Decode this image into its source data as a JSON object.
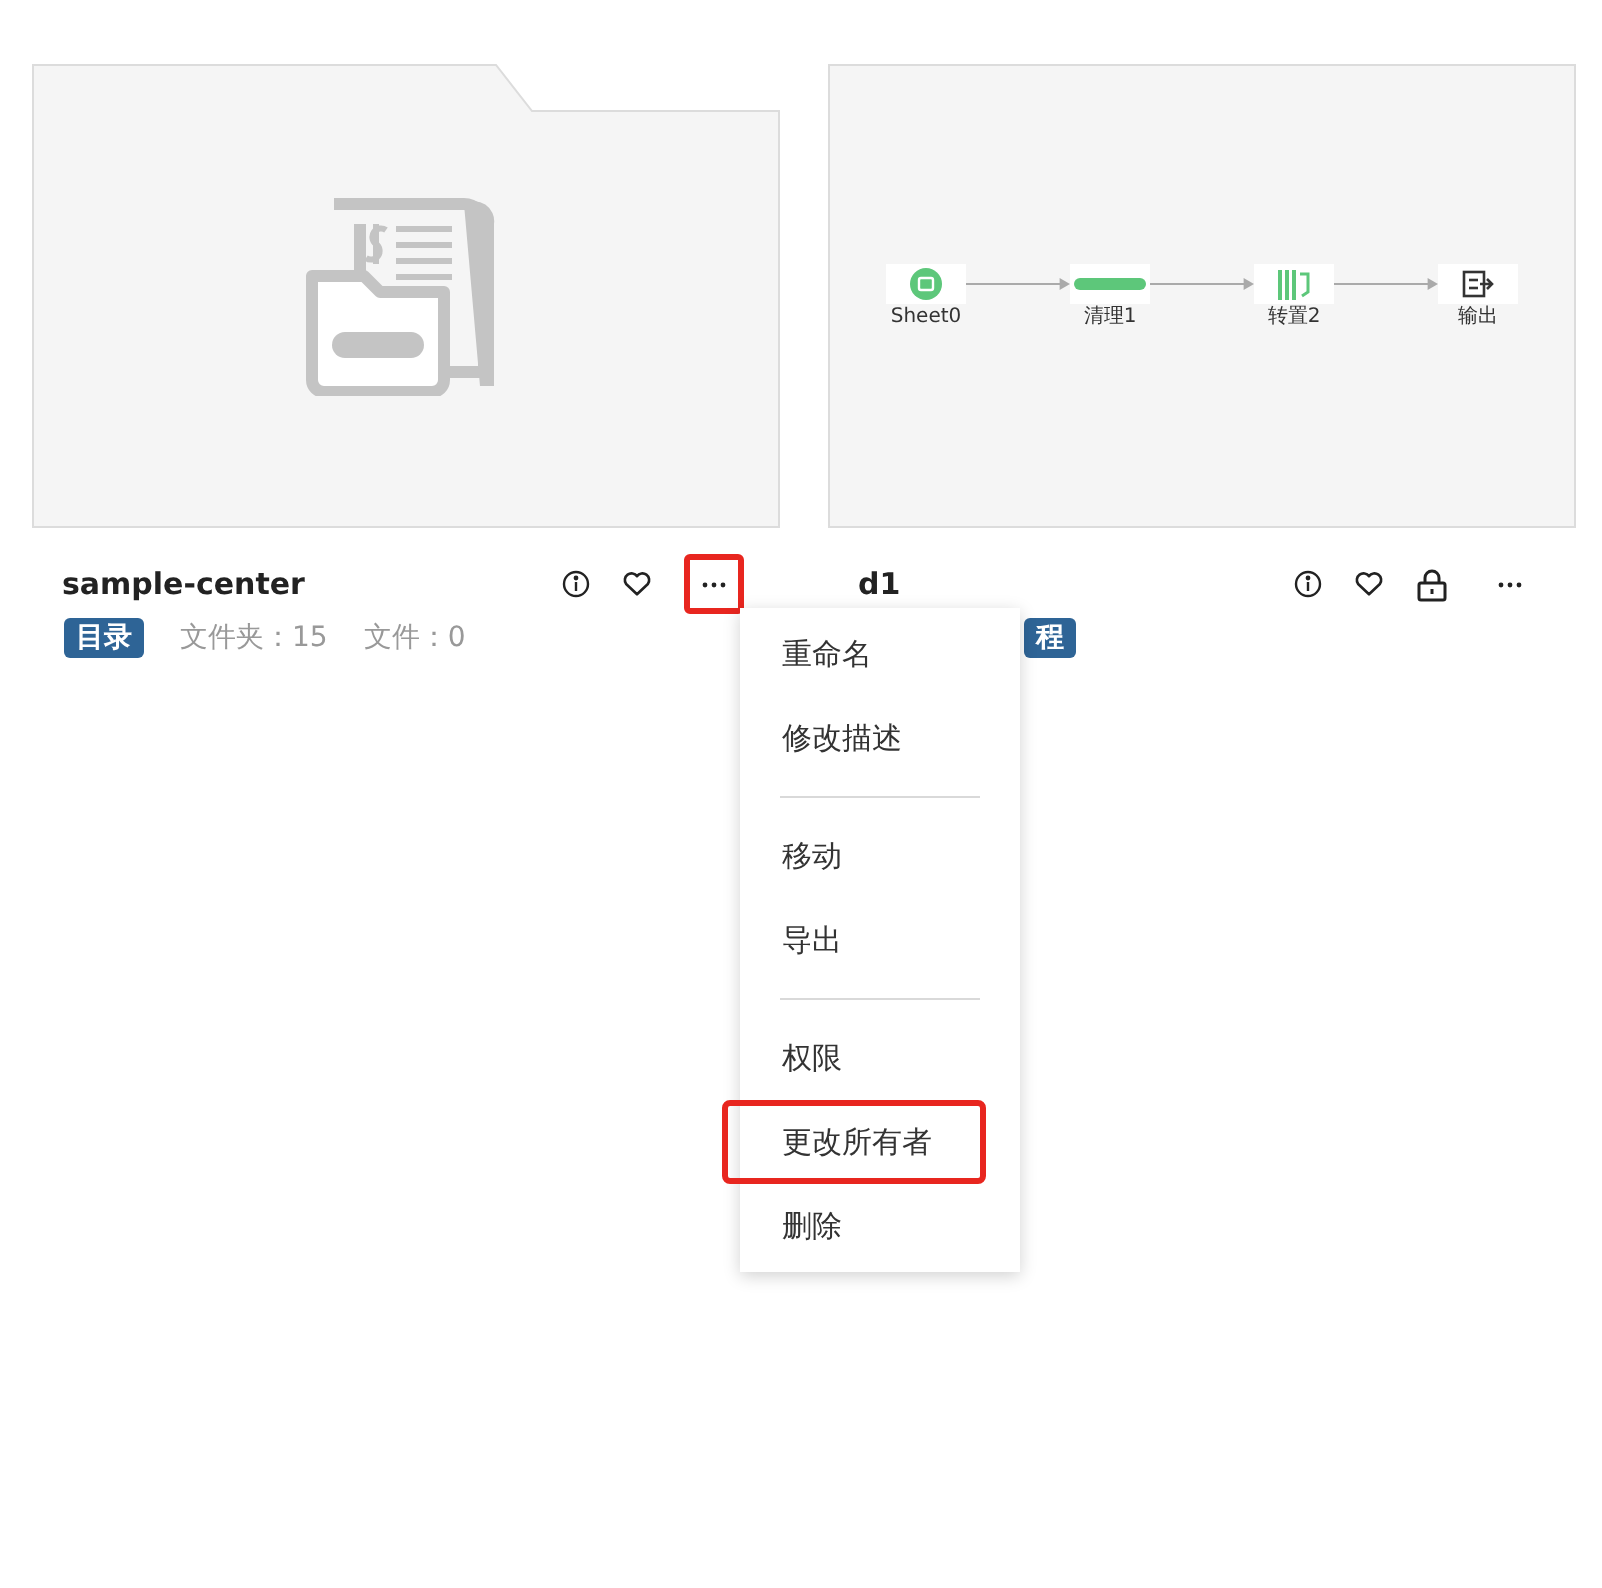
{
  "cards": [
    {
      "kind": "folder",
      "title": "sample-center",
      "tag": "目录",
      "stats": [
        "文件夹：15",
        "文件：0"
      ],
      "locked": false,
      "more_highlighted": true
    },
    {
      "kind": "flow",
      "title": "d1",
      "tag": "程",
      "locked": true,
      "more_highlighted": false,
      "flow": {
        "nodes": [
          {
            "kind": "sheet",
            "label": "Sheet0"
          },
          {
            "kind": "clean",
            "label": "清理1"
          },
          {
            "kind": "transpose",
            "label": "转置2"
          },
          {
            "kind": "output",
            "label": "输出"
          }
        ]
      }
    }
  ],
  "menu": {
    "items": [
      {
        "kind": "item",
        "label": "重命名",
        "highlighted": false
      },
      {
        "kind": "item",
        "label": "修改描述",
        "highlighted": false
      },
      {
        "kind": "divider"
      },
      {
        "kind": "item",
        "label": "移动",
        "highlighted": false
      },
      {
        "kind": "item",
        "label": "导出",
        "highlighted": false
      },
      {
        "kind": "divider"
      },
      {
        "kind": "item",
        "label": "权限",
        "highlighted": false
      },
      {
        "kind": "item",
        "label": "更改所有者",
        "highlighted": true
      },
      {
        "kind": "item",
        "label": "删除",
        "highlighted": false
      }
    ]
  }
}
